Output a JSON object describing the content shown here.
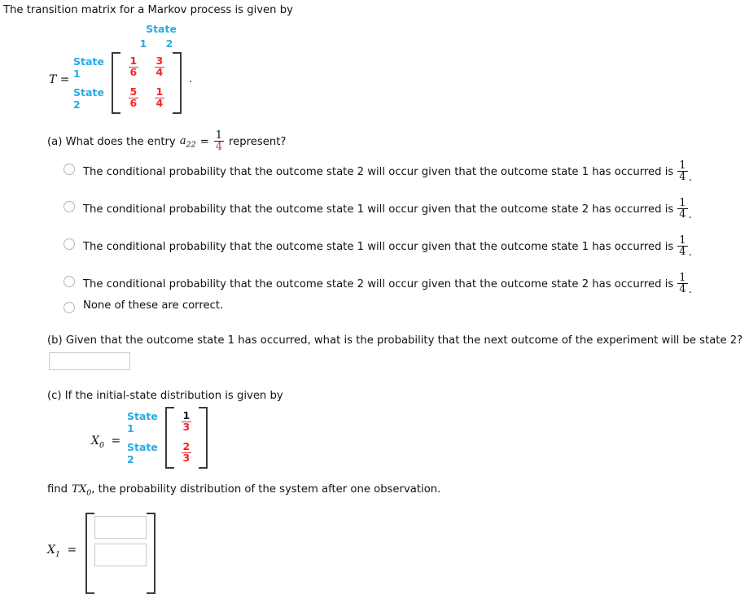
{
  "colors": {
    "blue": "#29abe2",
    "red": "#f5232a",
    "text": "#121212",
    "border": "#c9c9c9"
  },
  "intro": {
    "text": "The transition matrix for a Markov process is given by"
  },
  "transition_matrix": {
    "label": "T =",
    "col_header": "State",
    "col_labels": [
      "1",
      "2"
    ],
    "row_labels": [
      "State 1",
      "State 2"
    ],
    "entries": [
      [
        {
          "num": "1",
          "den": "6"
        },
        {
          "num": "3",
          "den": "4"
        }
      ],
      [
        {
          "num": "5",
          "den": "6"
        },
        {
          "num": "1",
          "den": "4"
        }
      ]
    ],
    "trailing_punctuation": "."
  },
  "part_a": {
    "prefix": "(a) What does the entry",
    "entry_symbol": "a",
    "entry_subscript": "22",
    "equals": "=",
    "value": {
      "num": "1",
      "den": "4"
    },
    "suffix": "represent?",
    "options": [
      {
        "text": "The conditional probability that the outcome state 2 will occur given that the outcome state 1 has occurred is",
        "value": {
          "num": "1",
          "den": "4"
        },
        "tail": "."
      },
      {
        "text": "The conditional probability that the outcome state 1 will occur given that the outcome state 2 has occurred is",
        "value": {
          "num": "1",
          "den": "4"
        },
        "tail": "."
      },
      {
        "text": "The conditional probability that the outcome state 1 will occur given that the outcome state 1 has occurred is",
        "value": {
          "num": "1",
          "den": "4"
        },
        "tail": "."
      },
      {
        "text": "The conditional probability that the outcome state 2 will occur given that the outcome state 2 has occurred is",
        "value": {
          "num": "1",
          "den": "4"
        },
        "tail": "."
      },
      {
        "text": "None of these are correct.",
        "value": null,
        "tail": ""
      }
    ]
  },
  "part_b": {
    "question": "(b) Given that the outcome state 1 has occurred, what is the probability that the next outcome of the experiment will be state 2?",
    "answer_value": ""
  },
  "part_c": {
    "question": "(c) If the initial-state distribution is given by",
    "x0": {
      "label": "X",
      "label_subscript": "0",
      "equals": "=",
      "row_labels": [
        "State 1",
        "State 2"
      ],
      "entries": [
        {
          "num": "1",
          "den": "3"
        },
        {
          "num": "2",
          "den": "3"
        }
      ]
    },
    "instruction_prefix": "find",
    "instruction_symbol": "TX",
    "instruction_subscript": "0",
    "instruction_suffix": ", the probability distribution of the system after one observation.",
    "x1": {
      "label": "X",
      "label_subscript": "1",
      "equals": "=",
      "answers": [
        "",
        ""
      ]
    }
  }
}
